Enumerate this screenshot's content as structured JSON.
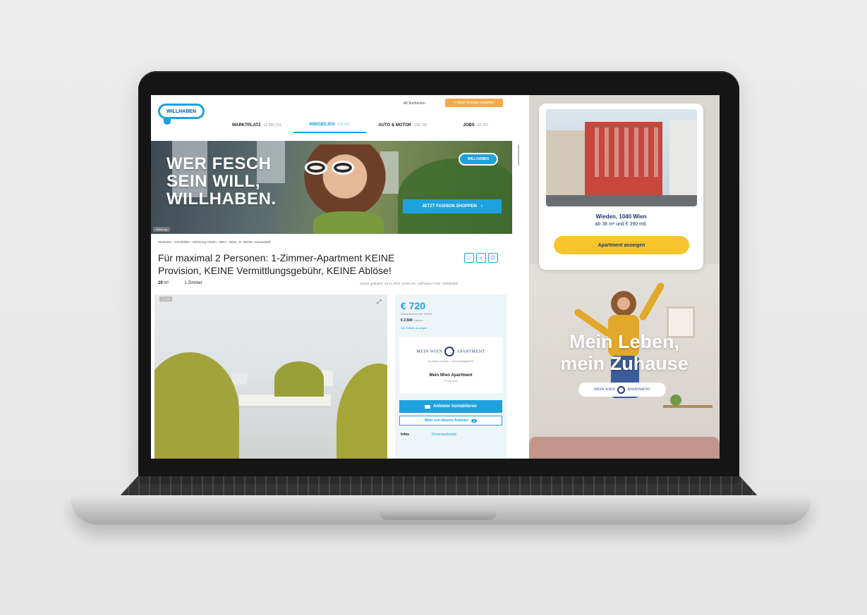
{
  "header": {
    "logo_text": "WILLHABEN",
    "top_link": "All Suchen/en",
    "cta_label": "+ Neue Anzeige aufgeben",
    "nav": [
      {
        "label": "MARKTPLATZ",
        "count": "12.080.114"
      },
      {
        "label": "IMMOBILIEN",
        "count": "156.582"
      },
      {
        "label": "AUTO & MOTOR",
        "count": "198.789"
      },
      {
        "label": "JOBS",
        "count": "16.292"
      }
    ]
  },
  "banner": {
    "line1": "WER FESCH",
    "line2": "SEIN WILL,",
    "line3": "WILLHABEN.",
    "logo_text": "WILLHABEN",
    "cta_label": "JETZT FASHION SHOPPEN",
    "ad_label": "Werbung"
  },
  "listing": {
    "breadcrumb": "Startseite › Immobilien › Wohnung mieten › Wien › Wien, 22. Bezirk, Donaustadt",
    "title": "Für maximal 2 Personen: 1-Zimmer-Apartment KEINE Provision, KEINE Vermittlungsgebühr, KEINE Ablöse!",
    "area_value": "29",
    "area_unit": "m²",
    "rooms": "1 Zimmer",
    "edited": "Zuletzt geändert: 20.11.2024, 14:00 Uhr | willhaben-Code: 783994280",
    "photo_tag": "1 / 13"
  },
  "panel": {
    "price": "€ 720",
    "price_sub": "Gesamtmiete inkl. MWSt",
    "deposit": "€ 2.500",
    "deposit_label": "Kaution",
    "price_link": "Alle Details anzeigen",
    "seller_logo": "MEIN WIEN",
    "seller_logo_2": "APARTMENT",
    "seller_sub": "Ihr liebes Zuhause – sofort einzugsbereit",
    "seller_name": "Mein Wien Apartment",
    "seller_role": "Privatperson",
    "contact_label": "Anbieter kontaktieren",
    "more_label": "Mehr von diesem Anbieter",
    "more_count": "8",
    "info_label": "Infos",
    "info_link": "Firmenwebseite"
  },
  "ad": {
    "location": "Wieden, 1040 Wien",
    "price_line": "ab 38 m² und € 390 mtl.",
    "button_label": "Apartment anzeigen",
    "slogan_1": "Mein Leben,",
    "slogan_2": "mein Zuhause",
    "brand": "MEIN WIEN",
    "brand_2": "APARTMENT"
  },
  "colors": {
    "brand_blue": "#1ea2dd",
    "ad_yellow": "#f7c52b",
    "cta_orange": "#f6a949"
  }
}
